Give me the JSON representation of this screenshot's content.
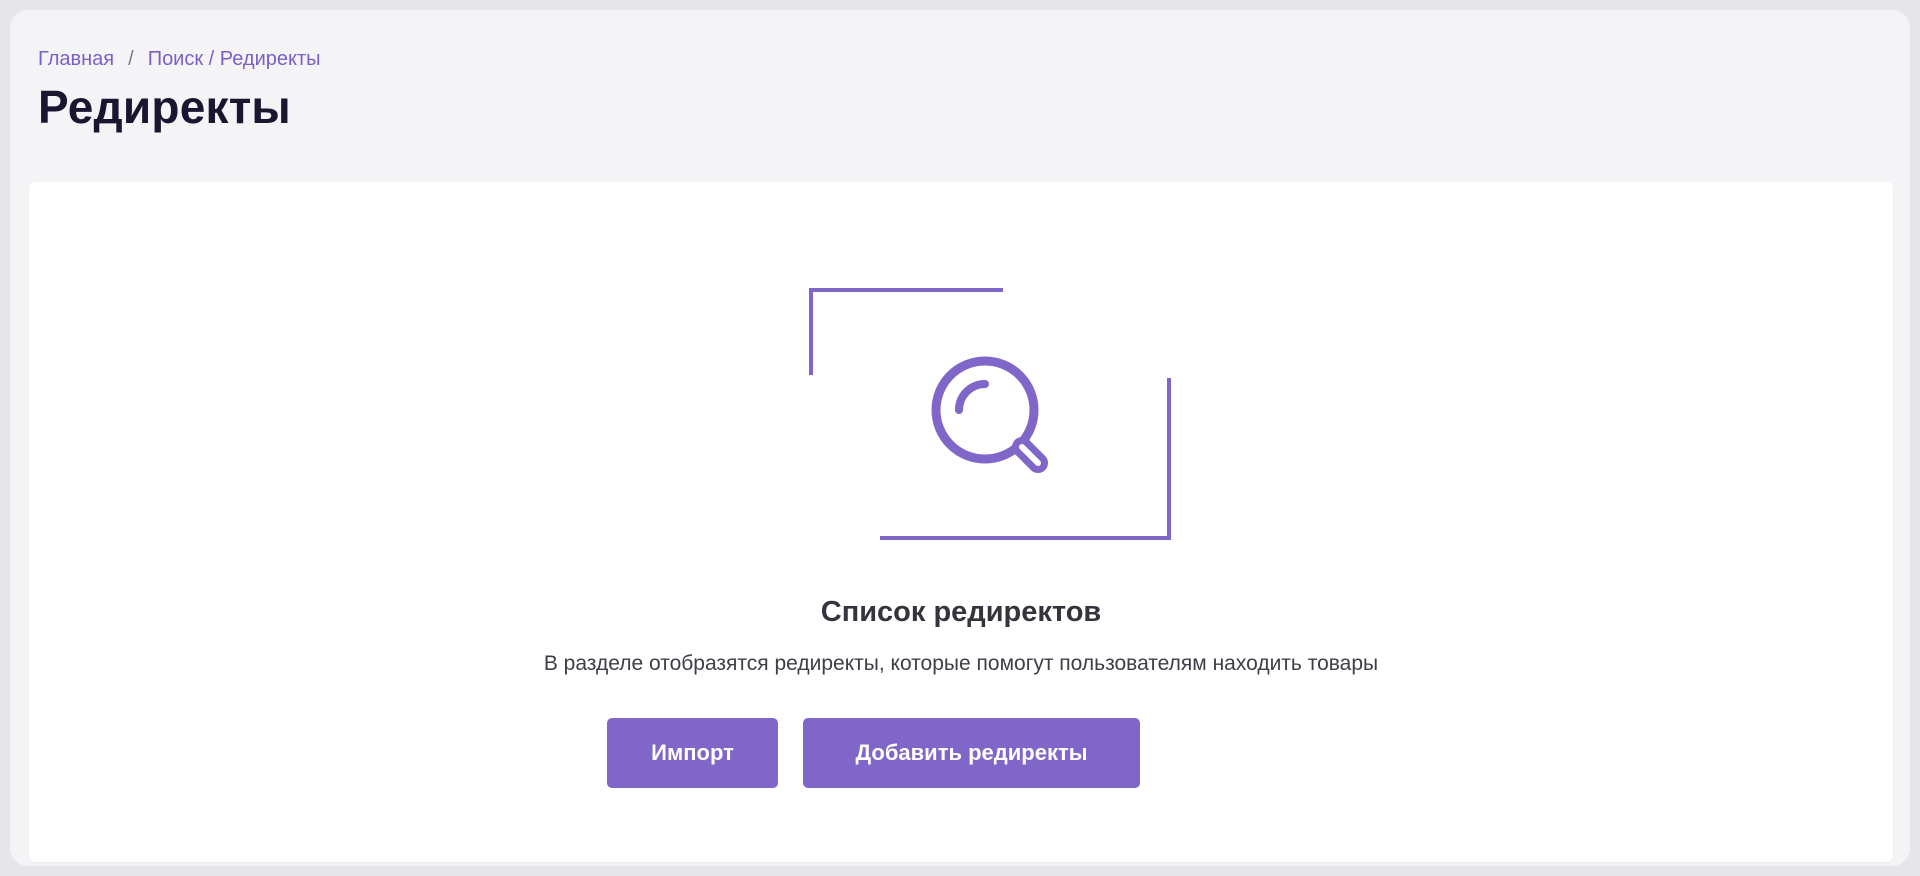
{
  "breadcrumb": {
    "home": "Главная",
    "separator": "/",
    "current": "Поиск / Редиректы"
  },
  "page": {
    "title": "Редиректы"
  },
  "empty_state": {
    "icon": "search-icon",
    "title": "Список редиректов",
    "description": "В разделе отобразятся редиректы, которые помогут пользователям находить товары"
  },
  "actions": {
    "import_label": "Импорт",
    "add_label": "Добавить редиректы"
  },
  "colors": {
    "accent": "#7f66c8",
    "title_text": "#1b1530",
    "background": "#f4f4f6"
  }
}
